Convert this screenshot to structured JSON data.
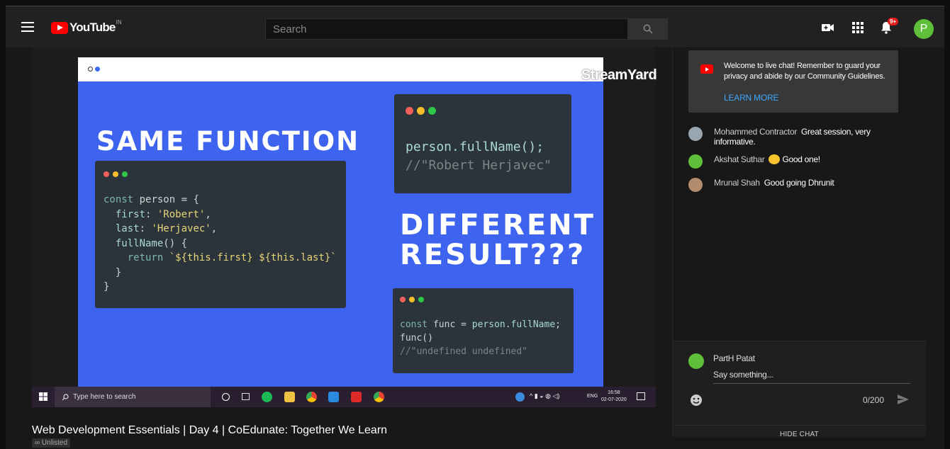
{
  "header": {
    "logo_text": "YouTube",
    "country": "IN",
    "search_placeholder": "Search",
    "notification_count": "9+",
    "avatar_letter": "P"
  },
  "video": {
    "streamyard_label": "StreamYard",
    "slide": {
      "headline1": "SAME FUNCTION",
      "headline2_line1": "DIFFERENT",
      "headline2_line2": "RESULT???",
      "code_left": [
        "const person = {",
        "  first: 'Robert',",
        "  last: 'Herjavec',",
        "  fullName() {",
        "    return `${this.first} ${this.last}`",
        "  }",
        "}"
      ],
      "code_top_right": [
        "person.fullName();",
        "//\"Robert Herjavec\""
      ],
      "code_bottom_right": [
        "const func = person.fullName;",
        "func()",
        "//\"undefined undefined\""
      ]
    },
    "taskbar": {
      "search_text": "Type here to search",
      "lang": "ENG",
      "time": "16:58",
      "date": "02-07-2020"
    }
  },
  "title": "Web Development Essentials | Day 4 | CoEdunate: Together We Learn",
  "visibility": "Unlisted",
  "chat": {
    "welcome": "Welcome to live chat! Remember to guard your privacy and abide by our Community Guidelines.",
    "learn_more": "LEARN MORE",
    "messages": [
      {
        "author": "Mohammed Contractor",
        "text": "Great session, very informative."
      },
      {
        "author": "Akshat Suthar",
        "text": "Good one!"
      },
      {
        "author": "Mrunal Shah",
        "text": "Good going Dhrunit"
      }
    ],
    "current_user": "PartH Patat",
    "input_placeholder": "Say something...",
    "char_count": "0/200",
    "hide_chat": "HIDE CHAT"
  },
  "colors": {
    "slide_blue": "#3e63ee",
    "brand_red": "#ff0000",
    "link_blue": "#3ea6ff",
    "avatar_green": "#5fbf3a"
  }
}
